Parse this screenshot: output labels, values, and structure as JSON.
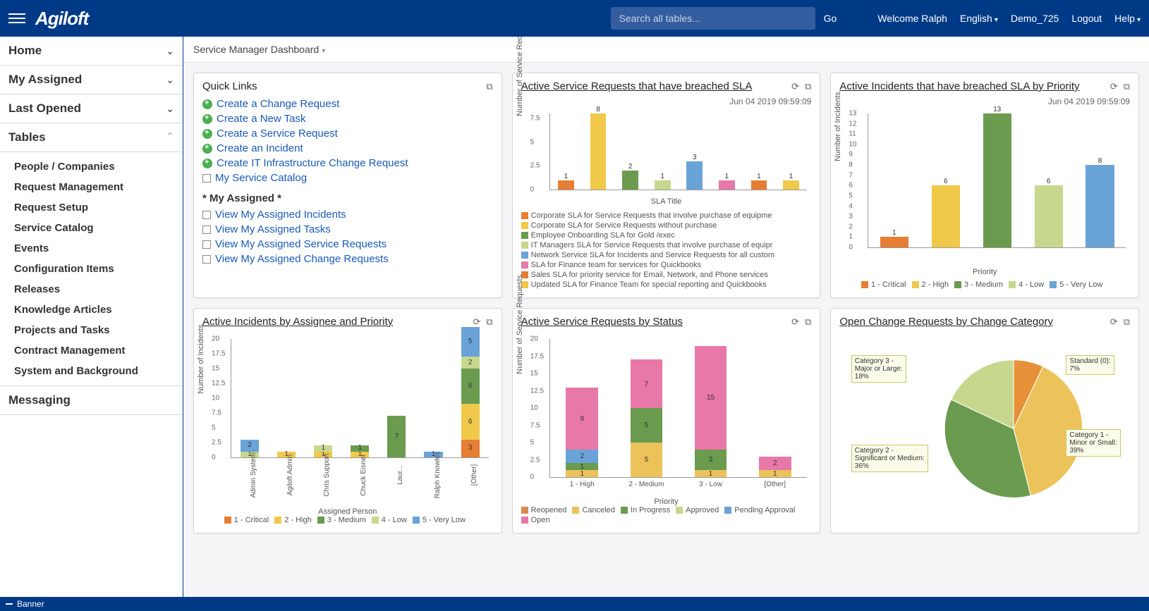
{
  "header": {
    "logo": "Agiloft",
    "search_placeholder": "Search all tables...",
    "go": "Go",
    "welcome": "Welcome Ralph",
    "language": "English",
    "demo": "Demo_725",
    "logout": "Logout",
    "help": "Help"
  },
  "sidebar": {
    "sections": [
      {
        "label": "Home"
      },
      {
        "label": "My Assigned"
      },
      {
        "label": "Last Opened"
      }
    ],
    "tables_heading": "Tables",
    "tables": [
      "People / Companies",
      "Request Management",
      "Request Setup",
      "Service Catalog",
      "Events",
      "Configuration Items",
      "Releases",
      "Knowledge Articles",
      "Projects and Tasks",
      "Contract Management",
      "System and Background"
    ],
    "messaging": "Messaging"
  },
  "dashboard_title": "Service Manager Dashboard",
  "cards": {
    "quick_links": {
      "title": "Quick Links",
      "create": [
        "Create a Change Request",
        "Create a New Task",
        "Create a Service Request",
        "Create an Incident",
        "Create IT Infrastructure Change Request"
      ],
      "catalog": "My Service Catalog",
      "assigned_title": "* My Assigned *",
      "assigned": [
        "View My Assigned Incidents",
        "View My Assigned Tasks",
        "View My Assigned Service Requests",
        "View My Assigned Change Requests"
      ]
    },
    "sla_breach": {
      "title": "Active Service Requests that have breached SLA",
      "timestamp": "Jun 04 2019 09:59:09",
      "xlabel": "SLA Title",
      "ylabel": "Number of Service Reque"
    },
    "incidents_priority": {
      "title": "Active Incidents that have breached SLA by Priority",
      "timestamp": "Jun 04 2019 09:59:09",
      "xlabel": "Priority",
      "ylabel": "Number of Incidents"
    },
    "incidents_assignee": {
      "title": "Active Incidents by Assignee and Priority",
      "xlabel": "Assigned Person",
      "ylabel": "Number of Incidents"
    },
    "requests_status": {
      "title": "Active Service Requests by Status",
      "xlabel": "Priority",
      "ylabel": "Number of Service Requests"
    },
    "change_requests": {
      "title": "Open Change Requests by Change Category"
    }
  },
  "footer": "Banner",
  "colors": {
    "critical": "#e67e33",
    "high": "#f0c94a",
    "medium": "#6a9b4e",
    "low": "#c7d88e",
    "verylow": "#6aa3d8",
    "pink": "#e878a8",
    "reopened": "#d88a52",
    "canceled": "#ecc35a",
    "inprogress": "#6a9b4e",
    "approved": "#c7d88e",
    "pending": "#6aa3d8",
    "open": "#e878a8",
    "pie_std": "#e69138",
    "pie_c1": "#ecc35a",
    "pie_c2": "#6a9b4e",
    "pie_c3": "#c7d88e"
  },
  "chart_data": [
    {
      "id": "sla_breach",
      "type": "bar",
      "title": "Active Service Requests that have breached SLA",
      "xlabel": "SLA Title",
      "ylabel": "Number of Service Reque",
      "ylim": [
        0,
        8
      ],
      "yticks": [
        0.0,
        2.5,
        5.0,
        7.5
      ],
      "categories": [
        "Corporate SLA for Service Requests that involve purchase of equipme",
        "Corporate SLA for Service Requests without purchase",
        "Employee Onboarding SLA for Gold /exec",
        "IT Managers SLA for Service Requests that involve purchase of equipr",
        "Network Service SLA for Incidents and Service Requests for all custom",
        "SLA for Finance team for services for Quickbooks",
        "Sales SLA for priority service for Email, Network, and Phone services",
        "Updated SLA for Finance Team for special reporting and Quickbooks"
      ],
      "values": [
        1,
        8,
        2,
        1,
        3,
        1,
        1,
        1
      ],
      "series_colors": [
        "#e67e33",
        "#f0c94a",
        "#6a9b4e",
        "#c7d88e",
        "#6aa3d8",
        "#e878a8",
        "#e67e33",
        "#f0c94a"
      ]
    },
    {
      "id": "incidents_priority",
      "type": "bar",
      "title": "Active Incidents that have breached SLA by Priority",
      "xlabel": "Priority",
      "ylabel": "Number of Incidents",
      "ylim": [
        0,
        13
      ],
      "yticks": [
        0,
        1,
        2,
        3,
        4,
        5,
        6,
        7,
        8,
        9,
        10,
        11,
        12,
        13
      ],
      "categories": [
        "1 - Critical",
        "2 - High",
        "3 - Medium",
        "4 - Low",
        "5 - Very Low"
      ],
      "values": [
        1,
        6,
        13,
        6,
        8
      ],
      "series_colors": [
        "#e67e33",
        "#f0c94a",
        "#6a9b4e",
        "#c7d88e",
        "#6aa3d8"
      ],
      "legend": [
        "1 - Critical",
        "2 - High",
        "3 - Medium",
        "4 - Low",
        "5 - Very Low"
      ]
    },
    {
      "id": "incidents_assignee",
      "type": "stacked-bar",
      "title": "Active Incidents by Assignee and Priority",
      "xlabel": "Assigned Person",
      "ylabel": "Number of Incidents",
      "ylim": [
        0,
        20
      ],
      "yticks": [
        0.0,
        2.5,
        5.0,
        7.5,
        10.0,
        12.5,
        15.0,
        17.5,
        20.0
      ],
      "categories": [
        "Admin System",
        "Agiloft Admin",
        "Chris Support",
        "Chuck Eisner",
        "Laur...",
        "Ralph Knowles",
        "[Other]"
      ],
      "series": [
        {
          "name": "1 - Critical",
          "color": "#e67e33",
          "values": [
            0,
            0,
            0,
            0,
            0,
            0,
            3
          ]
        },
        {
          "name": "2 - High",
          "color": "#f0c94a",
          "values": [
            0,
            1,
            1,
            1,
            0,
            0,
            6
          ]
        },
        {
          "name": "3 - Medium",
          "color": "#6a9b4e",
          "values": [
            0,
            0,
            0,
            1,
            7,
            0,
            6
          ]
        },
        {
          "name": "4 - Low",
          "color": "#c7d88e",
          "values": [
            1,
            0,
            1,
            0,
            0,
            0,
            2
          ]
        },
        {
          "name": "5 - Very Low",
          "color": "#6aa3d8",
          "values": [
            2,
            0,
            0,
            0,
            0,
            1,
            5
          ]
        }
      ]
    },
    {
      "id": "requests_status",
      "type": "stacked-bar",
      "title": "Active Service Requests by Status",
      "xlabel": "Priority",
      "ylabel": "Number of Service Requests",
      "ylim": [
        0,
        20
      ],
      "yticks": [
        0.0,
        2.5,
        5.0,
        7.5,
        10.0,
        12.5,
        15.0,
        17.5,
        20.0
      ],
      "categories": [
        "1 - High",
        "2 - Medium",
        "3 - Low",
        "[Other]"
      ],
      "series": [
        {
          "name": "Reopened",
          "color": "#d88a52",
          "values": [
            0,
            0,
            0,
            0
          ]
        },
        {
          "name": "Canceled",
          "color": "#ecc35a",
          "values": [
            1,
            5,
            1,
            1
          ]
        },
        {
          "name": "In Progress",
          "color": "#6a9b4e",
          "values": [
            1,
            5,
            3,
            0
          ]
        },
        {
          "name": "Approved",
          "color": "#c7d88e",
          "values": [
            0,
            0,
            0,
            0
          ]
        },
        {
          "name": "Pending Approval",
          "color": "#6aa3d8",
          "values": [
            2,
            0,
            0,
            0
          ]
        },
        {
          "name": "Open",
          "color": "#e878a8",
          "values": [
            9,
            7,
            15,
            2
          ]
        }
      ]
    },
    {
      "id": "change_requests",
      "type": "pie",
      "title": "Open Change Requests by Change Category",
      "slices": [
        {
          "label": "Standard (0): 7%",
          "value": 7,
          "color": "#e69138"
        },
        {
          "label": "Category 1 - Minor or Small: 39%",
          "value": 39,
          "color": "#ecc35a"
        },
        {
          "label": "Category 2 - Significant or Medium: 36%",
          "value": 36,
          "color": "#6a9b4e"
        },
        {
          "label": "Category 3 - Major or Large: 18%",
          "value": 18,
          "color": "#c7d88e"
        }
      ]
    }
  ]
}
